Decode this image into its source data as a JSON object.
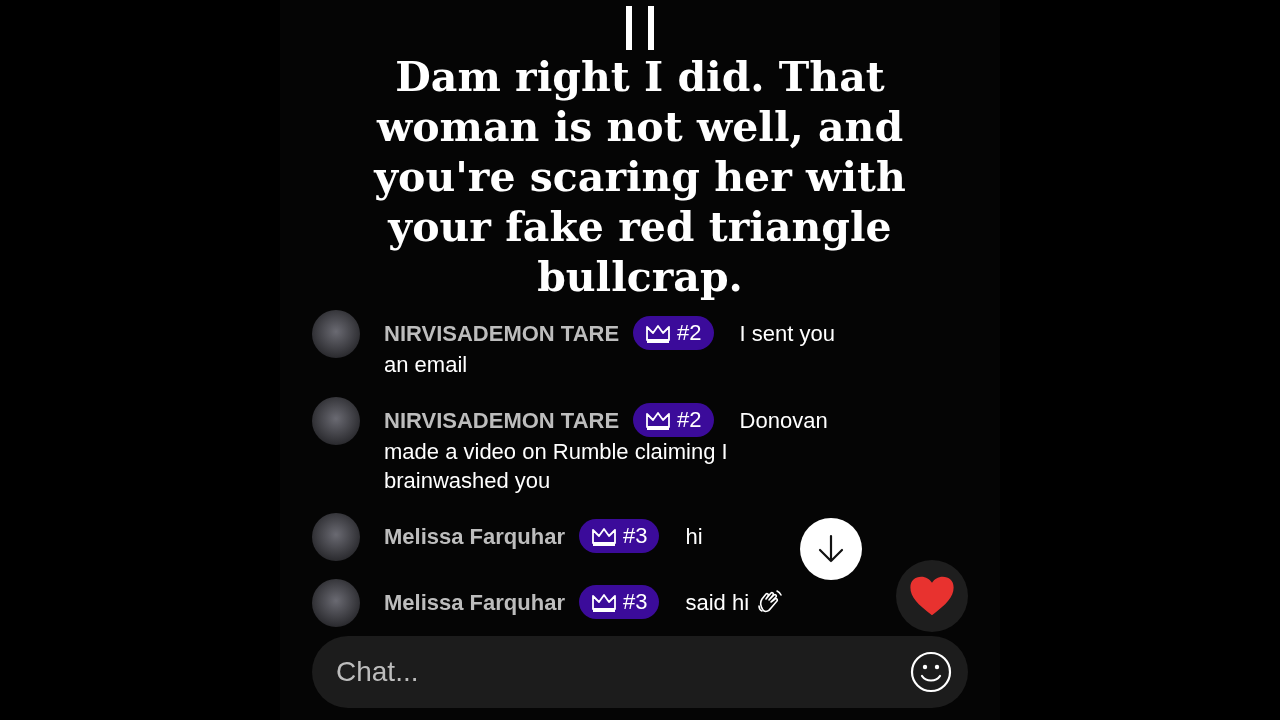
{
  "caption": {
    "text": "Dam right I did. That woman is not well, and you're scaring her with your fake red triangle bullcrap."
  },
  "messages": [
    {
      "kind": "text",
      "user": "NIRVISADEMON TARE",
      "rank": "#2",
      "lines": [
        "I sent you",
        "an email"
      ]
    },
    {
      "kind": "text",
      "user": "NIRVISADEMON TARE",
      "rank": "#2",
      "lines": [
        "Donovan",
        "made a video on Rumble claiming I",
        "brainwashed you"
      ]
    },
    {
      "kind": "text",
      "user": "Melissa Farquhar",
      "rank": "#3",
      "lines": [
        "hi"
      ]
    },
    {
      "kind": "wave",
      "user": "Melissa Farquhar",
      "rank": "#3",
      "lines": [
        "said hi"
      ]
    }
  ],
  "chat_input": {
    "placeholder": "Chat..."
  }
}
